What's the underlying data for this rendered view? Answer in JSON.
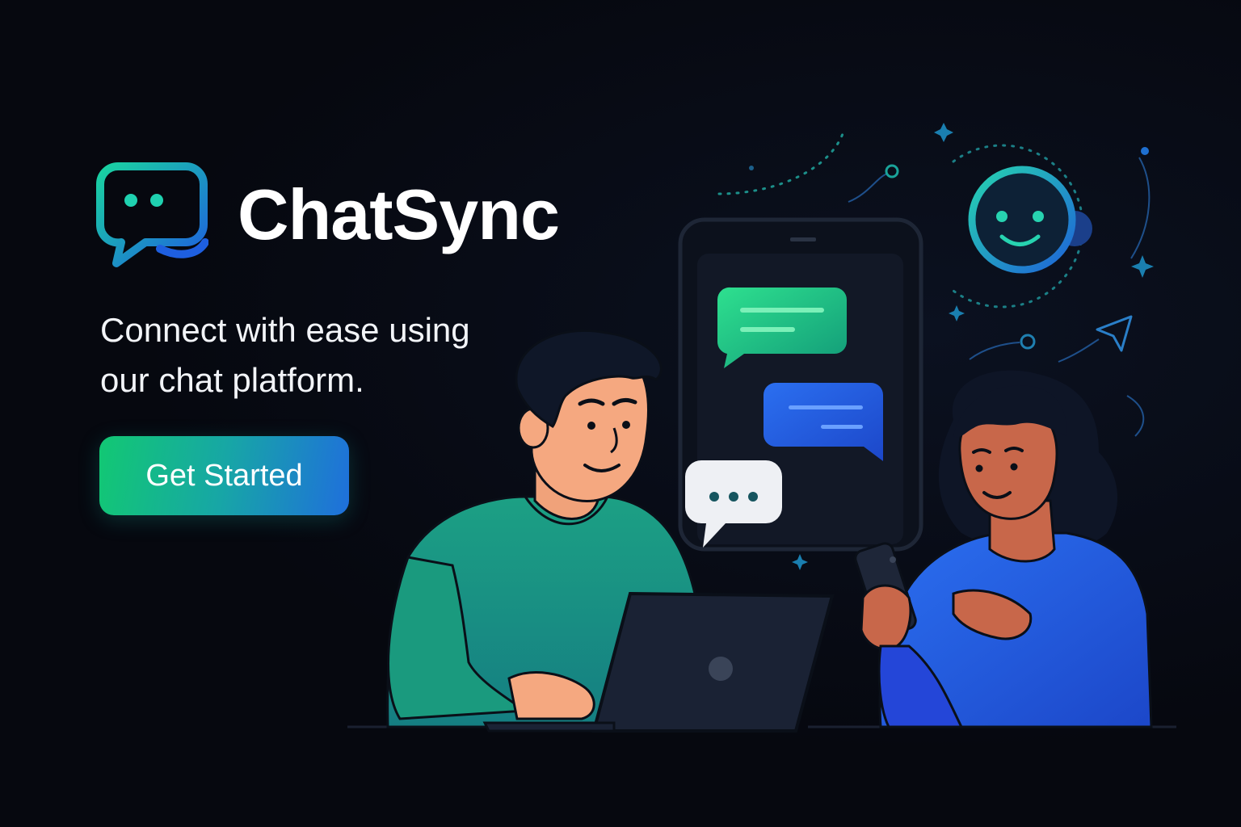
{
  "brand": {
    "name": "ChatSync",
    "logo_icon": "chat-bubble-icon"
  },
  "hero": {
    "tagline": "Connect with ease using our chat platform.",
    "cta_label": "Get Started"
  },
  "colors": {
    "background": "#06080f",
    "accent_green": "#12c873",
    "accent_blue": "#1f6fdc",
    "shirt_teal": "#1a9a7e",
    "shirt_blue": "#2446d8"
  },
  "icons": [
    "chat-bubble-icon",
    "typing-bubble-icon",
    "smiley-bot-icon",
    "sparkle-icon",
    "send-arrow-icon"
  ]
}
